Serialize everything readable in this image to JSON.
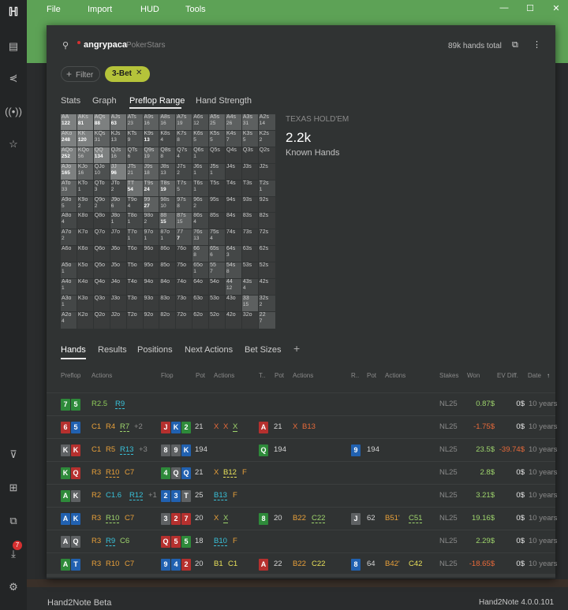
{
  "menu": {
    "file": "File",
    "import": "Import",
    "hud": "HUD",
    "tools": "Tools"
  },
  "window_controls": {
    "minimize": "—",
    "maximize": "☐",
    "close": "✕"
  },
  "player": {
    "name": "angrypaca",
    "site": "PokerStars",
    "hands_total": "89k hands total"
  },
  "filter": {
    "label": "Filter",
    "chip": "3-Bet"
  },
  "tabs": [
    "Stats",
    "Graph",
    "Preflop Range",
    "Hand Strength"
  ],
  "active_tab": "Preflop Range",
  "range": {
    "game": "TEXAS HOLD'EM",
    "count": "2.2k",
    "count_label": "Known Hands"
  },
  "grid": [
    [
      [
        "AA",
        "122",
        1
      ],
      [
        "AKs",
        "81",
        1
      ],
      [
        "AQs",
        "88",
        1
      ],
      [
        "AJs",
        "63",
        1
      ],
      [
        "ATs",
        "23",
        0
      ],
      [
        "A9s",
        "16",
        0
      ],
      [
        "A8s",
        "16",
        0
      ],
      [
        "A7s",
        "19",
        0
      ],
      [
        "A6s",
        "12",
        0
      ],
      [
        "A5s",
        "25",
        0
      ],
      [
        "A4s",
        "26",
        0
      ],
      [
        "A3s",
        "31",
        0
      ],
      [
        "A2s",
        "14",
        0
      ]
    ],
    [
      [
        "AKo",
        "248",
        1
      ],
      [
        "KK",
        "120",
        1
      ],
      [
        "KQs",
        "31",
        0
      ],
      [
        "KJs",
        "13",
        0
      ],
      [
        "KTs",
        "9",
        0
      ],
      [
        "K9s",
        "13",
        1
      ],
      [
        "K8s",
        "4",
        0
      ],
      [
        "K7s",
        "8",
        0
      ],
      [
        "K6s",
        "5",
        0
      ],
      [
        "K5s",
        "5",
        0
      ],
      [
        "K4s",
        "7",
        0
      ],
      [
        "K3s",
        "5",
        0
      ],
      [
        "K2s",
        "2",
        0
      ]
    ],
    [
      [
        "AQo",
        "252",
        1
      ],
      [
        "KQo",
        "56",
        0
      ],
      [
        "QQ",
        "134",
        1
      ],
      [
        "QJs",
        "16",
        0
      ],
      [
        "QTs",
        "6",
        0
      ],
      [
        "Q9s",
        "19",
        0
      ],
      [
        "Q8s",
        "8",
        0
      ],
      [
        "Q7s",
        "4",
        0
      ],
      [
        "Q6s",
        "1",
        0
      ],
      [
        "Q5s",
        "",
        0
      ],
      [
        "Q4s",
        "",
        0
      ],
      [
        "Q3s",
        "",
        0
      ],
      [
        "Q2s",
        "",
        0
      ]
    ],
    [
      [
        "AJo",
        "165",
        1
      ],
      [
        "KJo",
        "16",
        0
      ],
      [
        "QJo",
        "10",
        0
      ],
      [
        "JJ",
        "96",
        1
      ],
      [
        "JTs",
        "21",
        0
      ],
      [
        "J9s",
        "18",
        0
      ],
      [
        "J8s",
        "13",
        0
      ],
      [
        "J7s",
        "2",
        0
      ],
      [
        "J6s",
        "1",
        0
      ],
      [
        "J5s",
        "1",
        0
      ],
      [
        "J4s",
        "",
        0
      ],
      [
        "J3s",
        "",
        0
      ],
      [
        "J2s",
        "",
        0
      ]
    ],
    [
      [
        "ATo",
        "33",
        0
      ],
      [
        "KTo",
        "1",
        0
      ],
      [
        "QTo",
        "3",
        0
      ],
      [
        "JTo",
        "2",
        0
      ],
      [
        "TT",
        "54",
        1
      ],
      [
        "T9s",
        "24",
        1
      ],
      [
        "T8s",
        "19",
        1
      ],
      [
        "T7s",
        "5",
        0
      ],
      [
        "T6s",
        "1",
        0
      ],
      [
        "T5s",
        "",
        0
      ],
      [
        "T4s",
        "",
        0
      ],
      [
        "T3s",
        "",
        0
      ],
      [
        "T2s",
        "1",
        0
      ]
    ],
    [
      [
        "A9o",
        "5",
        0
      ],
      [
        "K9o",
        "2",
        0
      ],
      [
        "Q9o",
        "2",
        0
      ],
      [
        "J9o",
        "6",
        0
      ],
      [
        "T9o",
        "4",
        0
      ],
      [
        "99",
        "27",
        1
      ],
      [
        "98s",
        "10",
        0
      ],
      [
        "97s",
        "8",
        0
      ],
      [
        "96s",
        "2",
        0
      ],
      [
        "95s",
        "",
        0
      ],
      [
        "94s",
        "",
        0
      ],
      [
        "93s",
        "",
        0
      ],
      [
        "92s",
        "",
        0
      ]
    ],
    [
      [
        "A8o",
        "4",
        0
      ],
      [
        "K8o",
        "",
        0
      ],
      [
        "Q8o",
        "",
        0
      ],
      [
        "J8o",
        "1",
        0
      ],
      [
        "T8o",
        "1",
        0
      ],
      [
        "98o",
        "2",
        0
      ],
      [
        "88",
        "15",
        1
      ],
      [
        "87s",
        "15",
        0
      ],
      [
        "86s",
        "4",
        0
      ],
      [
        "85s",
        "",
        0
      ],
      [
        "84s",
        "",
        0
      ],
      [
        "83s",
        "",
        0
      ],
      [
        "82s",
        "",
        0
      ]
    ],
    [
      [
        "A7o",
        "2",
        0
      ],
      [
        "K7o",
        "",
        0
      ],
      [
        "Q7o",
        "",
        0
      ],
      [
        "J7o",
        "",
        0
      ],
      [
        "T7o",
        "1",
        0
      ],
      [
        "97o",
        "1",
        0
      ],
      [
        "87o",
        "1",
        0
      ],
      [
        "77",
        "7",
        1
      ],
      [
        "76s",
        "13",
        0
      ],
      [
        "75s",
        "4",
        0
      ],
      [
        "74s",
        "",
        0
      ],
      [
        "73s",
        "",
        0
      ],
      [
        "72s",
        "",
        0
      ]
    ],
    [
      [
        "A6o",
        "",
        0
      ],
      [
        "K6o",
        "",
        0
      ],
      [
        "Q6o",
        "",
        0
      ],
      [
        "J6o",
        "",
        0
      ],
      [
        "T6o",
        "",
        0
      ],
      [
        "96o",
        "",
        0
      ],
      [
        "86o",
        "",
        0
      ],
      [
        "76o",
        "",
        0
      ],
      [
        "66",
        "8",
        0
      ],
      [
        "65s",
        "6",
        0
      ],
      [
        "64s",
        "3",
        0
      ],
      [
        "63s",
        "",
        0
      ],
      [
        "62s",
        "",
        0
      ]
    ],
    [
      [
        "A5o",
        "1",
        0
      ],
      [
        "K5o",
        "",
        0
      ],
      [
        "Q5o",
        "",
        0
      ],
      [
        "J5o",
        "",
        0
      ],
      [
        "T5o",
        "",
        0
      ],
      [
        "95o",
        "",
        0
      ],
      [
        "85o",
        "",
        0
      ],
      [
        "75o",
        "",
        0
      ],
      [
        "65o",
        "1",
        0
      ],
      [
        "55",
        "7",
        0
      ],
      [
        "54s",
        "8",
        0
      ],
      [
        "53s",
        "",
        0
      ],
      [
        "52s",
        "",
        0
      ]
    ],
    [
      [
        "A4o",
        "1",
        0
      ],
      [
        "K4o",
        "",
        0
      ],
      [
        "Q4o",
        "",
        0
      ],
      [
        "J4o",
        "",
        0
      ],
      [
        "T4o",
        "",
        0
      ],
      [
        "94o",
        "",
        0
      ],
      [
        "84o",
        "",
        0
      ],
      [
        "74o",
        "",
        0
      ],
      [
        "64o",
        "",
        0
      ],
      [
        "54o",
        "",
        0
      ],
      [
        "44",
        "12",
        0
      ],
      [
        "43s",
        "4",
        0
      ],
      [
        "42s",
        "",
        0
      ]
    ],
    [
      [
        "A3o",
        "1",
        0
      ],
      [
        "K3o",
        "",
        0
      ],
      [
        "Q3o",
        "",
        0
      ],
      [
        "J3o",
        "",
        0
      ],
      [
        "T3o",
        "",
        0
      ],
      [
        "93o",
        "",
        0
      ],
      [
        "83o",
        "",
        0
      ],
      [
        "73o",
        "",
        0
      ],
      [
        "63o",
        "",
        0
      ],
      [
        "53o",
        "",
        0
      ],
      [
        "43o",
        "",
        0
      ],
      [
        "33",
        "15",
        0
      ],
      [
        "32s",
        "2",
        0
      ]
    ],
    [
      [
        "A2o",
        "4",
        0
      ],
      [
        "K2o",
        "",
        0
      ],
      [
        "Q2o",
        "",
        0
      ],
      [
        "J2o",
        "",
        0
      ],
      [
        "T2o",
        "",
        0
      ],
      [
        "92o",
        "",
        0
      ],
      [
        "82o",
        "",
        0
      ],
      [
        "72o",
        "",
        0
      ],
      [
        "62o",
        "",
        0
      ],
      [
        "52o",
        "",
        0
      ],
      [
        "42o",
        "",
        0
      ],
      [
        "32o",
        "",
        0
      ],
      [
        "22",
        "7",
        0
      ]
    ]
  ],
  "hand_tabs": [
    "Hands",
    "Results",
    "Positions",
    "Next Actions",
    "Bet Sizes"
  ],
  "columns": {
    "preflop": "Preflop",
    "actions": "Actions",
    "flop": "Flop",
    "pot": "Pot",
    "turn": "T..",
    "turn_pot": "Pot",
    "turn_actions": "Actions",
    "river": "R..",
    "river_pot": "Pot",
    "river_actions": "Actions",
    "stakes": "Stakes",
    "won": "Won",
    "ev": "EV Diff.",
    "date": "Date"
  },
  "hands": [
    {
      "hole": [
        [
          "7",
          "s"
        ],
        [
          "5",
          "s"
        ]
      ],
      "pf": [
        [
          "R2.5",
          "#8fcb5a",
          0
        ],
        [
          "R9",
          "#39c1d9",
          1
        ]
      ],
      "flop": [],
      "fpot": "",
      "fa": [],
      "turn": [],
      "tpot": "",
      "ta": [],
      "river": [],
      "rpot": "",
      "ra": [],
      "stakes": "NL25",
      "won": "0.87$",
      "won_color": "#9ed46c",
      "ev": "0$",
      "date": "10 years"
    },
    {
      "hole": [
        [
          "6",
          "h"
        ],
        [
          "5",
          "d"
        ]
      ],
      "pf": [
        [
          "C1",
          "#e8a03a",
          0
        ],
        [
          "R4",
          "#e8a03a",
          0
        ],
        [
          "R7",
          "#9ed46c",
          1
        ],
        [
          "+2",
          "#8a8a8a",
          0
        ]
      ],
      "flop": [
        [
          "J",
          "h"
        ],
        [
          "K",
          "d"
        ],
        [
          "2",
          "s"
        ]
      ],
      "fpot": "21",
      "fa": [
        [
          "X",
          "#e86a3a",
          0
        ],
        [
          "X",
          "#e86a3a",
          0
        ],
        [
          "X",
          "#9ed46c",
          1
        ]
      ],
      "turn": [
        [
          "A",
          "h"
        ]
      ],
      "tpot": "21",
      "ta": [
        [
          "X",
          "#e86a3a",
          0
        ],
        [
          "B13",
          "#e86a3a",
          0
        ]
      ],
      "river": [],
      "rpot": "",
      "ra": [],
      "stakes": "NL25",
      "won": "-1.75$",
      "won_color": "#e86a3a",
      "ev": "0$",
      "date": "10 years"
    },
    {
      "hole": [
        [
          "K",
          "c"
        ],
        [
          "K",
          "h"
        ]
      ],
      "pf": [
        [
          "C1",
          "#e8a03a",
          0
        ],
        [
          "R5",
          "#e8a03a",
          0
        ],
        [
          "R13",
          "#39c1d9",
          1
        ],
        [
          "+3",
          "#8a8a8a",
          0
        ]
      ],
      "flop": [
        [
          "8",
          "c"
        ],
        [
          "9",
          "c"
        ],
        [
          "K",
          "d"
        ]
      ],
      "fpot": "194",
      "fa": [],
      "turn": [
        [
          "Q",
          "s"
        ]
      ],
      "tpot": "194",
      "ta": [],
      "river": [
        [
          "9",
          "d"
        ]
      ],
      "rpot": "194",
      "ra": [],
      "stakes": "NL25",
      "won": "23.5$",
      "won_color": "#9ed46c",
      "ev": "-39.74$",
      "date": "10 years"
    },
    {
      "hole": [
        [
          "K",
          "s"
        ],
        [
          "Q",
          "h"
        ]
      ],
      "pf": [
        [
          "R3",
          "#e8a03a",
          0
        ],
        [
          "R10",
          "#e8a03a",
          1
        ],
        [
          "C7",
          "#e8a03a",
          0
        ]
      ],
      "flop": [
        [
          "4",
          "s"
        ],
        [
          "Q",
          "c"
        ],
        [
          "Q",
          "d"
        ]
      ],
      "fpot": "21",
      "fa": [
        [
          "X",
          "#e8a03a",
          0
        ],
        [
          "B12",
          "#e8e05a",
          1
        ],
        [
          "F",
          "#e8a03a",
          0
        ]
      ],
      "turn": [],
      "tpot": "",
      "ta": [],
      "river": [],
      "rpot": "",
      "ra": [],
      "stakes": "NL25",
      "won": "2.8$",
      "won_color": "#9ed46c",
      "ev": "0$",
      "date": "10 years"
    },
    {
      "hole": [
        [
          "A",
          "s"
        ],
        [
          "K",
          "c"
        ]
      ],
      "pf": [
        [
          "R2",
          "#e8a03a",
          0
        ],
        [
          "C1.6",
          "#39c1d9",
          0
        ],
        [
          "R12",
          "#39c1d9",
          1
        ],
        [
          "+1",
          "#8a8a8a",
          0
        ]
      ],
      "flop": [
        [
          "2",
          "d"
        ],
        [
          "3",
          "d"
        ],
        [
          "T",
          "c"
        ]
      ],
      "fpot": "25",
      "fa": [
        [
          "B13",
          "#39c1d9",
          1
        ],
        [
          "F",
          "#e8a03a",
          0
        ]
      ],
      "turn": [],
      "tpot": "",
      "ta": [],
      "river": [],
      "rpot": "",
      "ra": [],
      "stakes": "NL25",
      "won": "3.21$",
      "won_color": "#9ed46c",
      "ev": "0$",
      "date": "10 years"
    },
    {
      "hole": [
        [
          "A",
          "d"
        ],
        [
          "K",
          "d"
        ]
      ],
      "pf": [
        [
          "R3",
          "#e8a03a",
          0
        ],
        [
          "R10",
          "#9ed46c",
          1
        ],
        [
          "C7",
          "#e8a03a",
          0
        ]
      ],
      "flop": [
        [
          "3",
          "c"
        ],
        [
          "2",
          "h"
        ],
        [
          "7",
          "h"
        ]
      ],
      "fpot": "20",
      "fa": [
        [
          "X",
          "#e8a03a",
          0
        ],
        [
          "X",
          "#9ed46c",
          1
        ]
      ],
      "turn": [
        [
          "8",
          "s"
        ]
      ],
      "tpot": "20",
      "ta": [
        [
          "B22",
          "#e8a03a",
          0
        ],
        [
          "C22",
          "#9ed46c",
          1
        ]
      ],
      "river": [
        [
          "J",
          "c"
        ]
      ],
      "rpot": "62",
      "ra": [
        [
          "B51'",
          "#e8a03a",
          0
        ],
        [
          "C51",
          "#9ed46c",
          1
        ]
      ],
      "stakes": "NL25",
      "won": "19.16$",
      "won_color": "#9ed46c",
      "ev": "0$",
      "date": "10 years"
    },
    {
      "hole": [
        [
          "A",
          "c"
        ],
        [
          "Q",
          "c"
        ]
      ],
      "pf": [
        [
          "R3",
          "#e8a03a",
          0
        ],
        [
          "R9",
          "#39c1d9",
          1
        ],
        [
          "C6",
          "#9ed46c",
          0
        ]
      ],
      "flop": [
        [
          "Q",
          "h"
        ],
        [
          "5",
          "h"
        ],
        [
          "5",
          "s"
        ]
      ],
      "fpot": "18",
      "fa": [
        [
          "B10",
          "#39c1d9",
          1
        ],
        [
          "F",
          "#e8a03a",
          0
        ]
      ],
      "turn": [],
      "tpot": "",
      "ta": [],
      "river": [],
      "rpot": "",
      "ra": [],
      "stakes": "NL25",
      "won": "2.29$",
      "won_color": "#9ed46c",
      "ev": "0$",
      "date": "10 years"
    },
    {
      "hole": [
        [
          "A",
          "s"
        ],
        [
          "T",
          "d"
        ]
      ],
      "pf": [
        [
          "R3",
          "#e8a03a",
          0
        ],
        [
          "R10",
          "#e8a03a",
          0
        ],
        [
          "C7",
          "#e8a03a",
          0
        ]
      ],
      "flop": [
        [
          "9",
          "d"
        ],
        [
          "4",
          "d"
        ],
        [
          "2",
          "h"
        ]
      ],
      "fpot": "20",
      "fa": [
        [
          "B1",
          "#e8e05a",
          0
        ],
        [
          "C1",
          "#e8e05a",
          0
        ]
      ],
      "turn": [
        [
          "A",
          "h"
        ]
      ],
      "tpot": "22",
      "ta": [
        [
          "B22",
          "#e8a03a",
          0
        ],
        [
          "C22",
          "#e8e05a",
          0
        ]
      ],
      "river": [
        [
          "8",
          "d"
        ]
      ],
      "rpot": "64",
      "ra": [
        [
          "B42'",
          "#e8a03a",
          0
        ],
        [
          "C42",
          "#e8e05a",
          0
        ]
      ],
      "stakes": "NL25",
      "won": "-18.65$",
      "won_color": "#e86a3a",
      "ev": "0$",
      "date": "10 years"
    }
  ],
  "footer": {
    "left": "Hand2Note Beta",
    "right": "Hand2Note 4.0.0.101"
  },
  "badge": "7"
}
